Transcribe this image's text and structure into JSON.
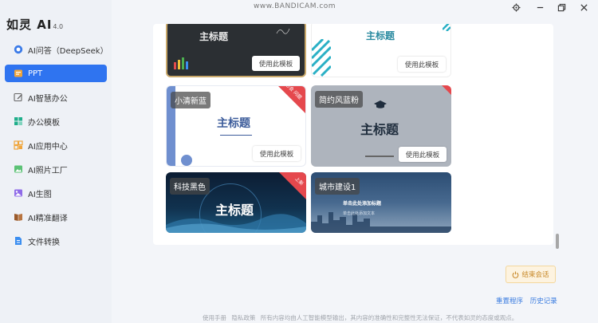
{
  "app": {
    "name": "如灵 AI",
    "version": "4.0"
  },
  "watermark": "www.BANDICAM.com",
  "nav": [
    {
      "label": "AI问答（DeepSeek）",
      "icon": "chat-bubble-icon",
      "active": false
    },
    {
      "label": "PPT",
      "icon": "ppt-icon",
      "active": true
    },
    {
      "label": "AI智慧办公",
      "icon": "edit-icon",
      "active": false
    },
    {
      "label": "办公模板",
      "icon": "template-icon",
      "active": false
    },
    {
      "label": "AI应用中心",
      "icon": "apps-icon",
      "active": false
    },
    {
      "label": "AI照片工厂",
      "icon": "photo-factory-icon",
      "active": false
    },
    {
      "label": "AI生图",
      "icon": "image-icon",
      "active": false
    },
    {
      "label": "AI精准翻译",
      "icon": "book-icon",
      "active": false
    },
    {
      "label": "文件转换",
      "icon": "file-icon",
      "active": false
    }
  ],
  "templates": {
    "use_label": "使用此模板",
    "t1": {
      "title": "主标题"
    },
    "t2": {
      "title": "主标题"
    },
    "t3": {
      "label": "小清新蓝",
      "title": "主标题",
      "badge": "必会 问题"
    },
    "t4": {
      "label": "简约风蓝粉",
      "title": "主标题"
    },
    "t5": {
      "label": "科技黑色",
      "title": "主标题",
      "badge": "上新"
    },
    "t6": {
      "label": "城市建设1",
      "title": "单击此处添加标题",
      "subtitle": "单击此处添加文本"
    }
  },
  "colors": {
    "accent": "#2f74f0",
    "teal": "#2a8aa0",
    "badge": "#e5484d"
  },
  "actions": {
    "end_session": "结束会话",
    "restart": "重置程序",
    "history": "历史记录"
  },
  "footer": {
    "manual": "使用手册",
    "privacy": "隐私政策",
    "disclaimer": "所有内容均由人工智能模型输出，其内容的准确性和完整性无法保证，不代表如灵的态度或观点。"
  }
}
